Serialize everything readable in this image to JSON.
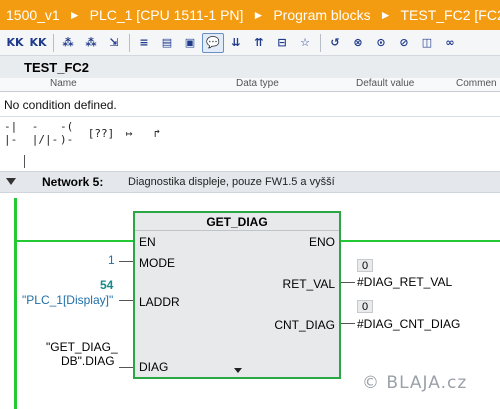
{
  "breadcrumb": [
    "1500_v1",
    "PLC_1 [CPU 1511-1 PN]",
    "Program blocks",
    "TEST_FC2 [FC2]"
  ],
  "breadcrumb_separator": "►",
  "toolbar": {
    "icons": [
      "kk-insert-icon",
      "kk-remove-icon",
      "insert-network-icon",
      "delete-network-icon",
      "go-to-network-icon",
      "interface-list-icon",
      "interface-table-icon",
      "block-interface-icon",
      "comment-icon",
      "insert-row-icon",
      "delete-row-icon",
      "indent-icon",
      "favorites-icon",
      "breakpoint-icon",
      "watch-icon",
      "reset-icon",
      "stop-icon",
      "monitor-icon",
      "glasses-icon"
    ],
    "glyphs": [
      "KK",
      "KK",
      "⁂",
      "⁂",
      "⇲",
      "≡",
      "▤",
      "▣",
      "💬",
      "⇊",
      "⇈",
      "⊟",
      "☆",
      "↺",
      "⊗",
      "⊙",
      "⊘",
      "◫",
      "∞"
    ],
    "active_index": 8
  },
  "block": {
    "name": "TEST_FC2",
    "columns": [
      "Name",
      "Data type",
      "Default value",
      "Commen"
    ]
  },
  "condition_text": "No condition defined.",
  "favorites": [
    {
      "name": "no-contact-icon",
      "glyph": "-| |-"
    },
    {
      "name": "nc-contact-icon",
      "glyph": "-|/|-"
    },
    {
      "name": "coil-icon",
      "glyph": "-( )-"
    },
    {
      "name": "empty-box-icon",
      "glyph": "[??]"
    },
    {
      "name": "open-branch-icon",
      "glyph": "↦"
    },
    {
      "name": "close-branch-icon",
      "glyph": "↱"
    }
  ],
  "network": {
    "title": "Network 5:",
    "comment": "Diagnostika displeje, pouze FW1.5 a vyšší",
    "function_block": {
      "name": "GET_DIAG",
      "inputs": [
        "EN",
        "MODE",
        "LADDR",
        "DIAG"
      ],
      "outputs": [
        "ENO",
        "RET_VAL",
        "CNT_DIAG"
      ]
    },
    "mode_value": "1",
    "laddr_number": "54",
    "laddr_value": "\"PLC_1[Display]\"",
    "diag_value_line1": "\"GET_DIAG_",
    "diag_value_line2": "DB\".DIAG",
    "ret_val_monitor": "0",
    "ret_val_var": "#DIAG_RET_VAL",
    "cnt_diag_monitor": "0",
    "cnt_diag_var": "#DIAG_CNT_DIAG"
  },
  "watermark": "© BLAJA.cz",
  "colors": {
    "breadcrumb_bg": "#f39c12",
    "power_flow": "#22c934",
    "block_border": "#2aa642",
    "tag_blue": "#1f6fa8"
  }
}
